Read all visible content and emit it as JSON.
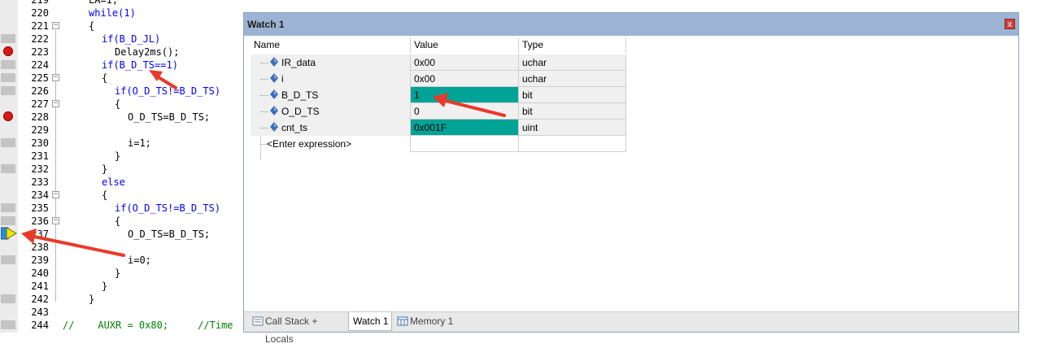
{
  "editor": {
    "lines": [
      {
        "num": "219",
        "code": "LA=1;"
      },
      {
        "num": "220",
        "code": "while(1)"
      },
      {
        "num": "221",
        "code": "{"
      },
      {
        "num": "222",
        "code": "if(B_D_JL)"
      },
      {
        "num": "223",
        "code": "Delay2ms();"
      },
      {
        "num": "224",
        "code": "if(B_D_TS==1)"
      },
      {
        "num": "225",
        "code": "{"
      },
      {
        "num": "226",
        "code": "if(O_D_TS!=B_D_TS)"
      },
      {
        "num": "227",
        "code": "{"
      },
      {
        "num": "228",
        "code": "O_D_TS=B_D_TS;"
      },
      {
        "num": "229",
        "code": ""
      },
      {
        "num": "230",
        "code": "i=1;"
      },
      {
        "num": "231",
        "code": "}"
      },
      {
        "num": "232",
        "code": "}"
      },
      {
        "num": "233",
        "code": "else"
      },
      {
        "num": "234",
        "code": "{"
      },
      {
        "num": "235",
        "code": "if(O_D_TS!=B_D_TS)"
      },
      {
        "num": "236",
        "code": "{"
      },
      {
        "num": "237",
        "code": "O_D_TS=B_D_TS;"
      },
      {
        "num": "238",
        "code": ""
      },
      {
        "num": "239",
        "code": "i=0;"
      },
      {
        "num": "240",
        "code": "}"
      },
      {
        "num": "241",
        "code": "}"
      },
      {
        "num": "242",
        "code": "}"
      },
      {
        "num": "243",
        "code": ""
      },
      {
        "num": "244",
        "code": "//    AUXR = 0x80;     //Time"
      }
    ],
    "breakpoint_lines": [
      "223",
      "228"
    ],
    "current_line": "237"
  },
  "watch": {
    "title": "Watch 1",
    "close_glyph": "x",
    "columns": {
      "name": "Name",
      "value": "Value",
      "type": "Type"
    },
    "rows": [
      {
        "name": "IR_data",
        "value": "0x00",
        "type": "uchar",
        "changed": false
      },
      {
        "name": "i",
        "value": "0x00",
        "type": "uchar",
        "changed": false
      },
      {
        "name": "B_D_TS",
        "value": "1",
        "type": "bit",
        "changed": true
      },
      {
        "name": "O_D_TS",
        "value": "0",
        "type": "bit",
        "changed": false
      },
      {
        "name": "cnt_ts",
        "value": "0x001F",
        "type": "uint",
        "changed": true
      }
    ],
    "enter_expression": "<Enter expression>",
    "highlight_color": "#00a396",
    "tabs": [
      {
        "label": "Call Stack + Locals",
        "icon": "call-stack-icon",
        "active": false
      },
      {
        "label": "Watch 1",
        "icon": "",
        "active": true
      },
      {
        "label": "Memory 1",
        "icon": "memory-icon",
        "active": false
      }
    ]
  },
  "colors": {
    "keyword": "#0000ff",
    "number": "#8b008b",
    "comment": "#008000",
    "breakpoint": "#e01515",
    "annotation_arrow": "#e83a2a",
    "title_bar": "#9db3d4"
  }
}
